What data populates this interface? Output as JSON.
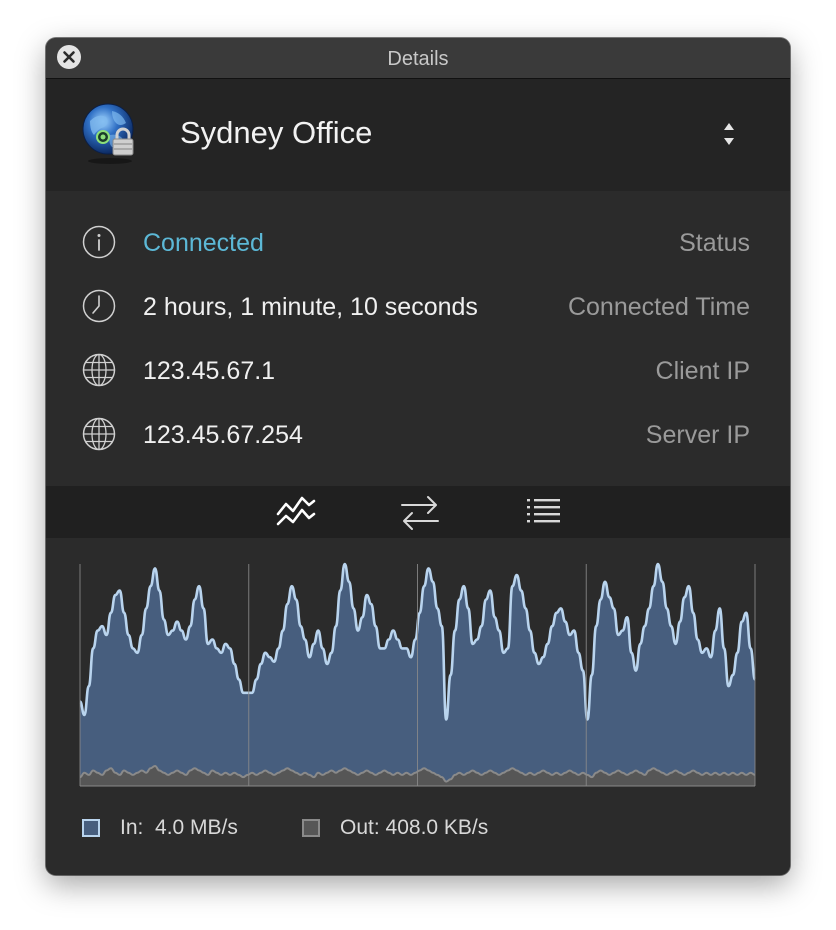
{
  "window": {
    "title": "Details"
  },
  "header": {
    "connection_name": "Sydney Office"
  },
  "info": {
    "rows": [
      {
        "value": "Connected",
        "label": "Status",
        "icon": "info-icon"
      },
      {
        "value": "2 hours, 1 minute, 10 seconds",
        "label": "Connected Time",
        "icon": "clock-icon"
      },
      {
        "value": "123.45.67.1",
        "label": "Client IP",
        "icon": "globe-icon"
      },
      {
        "value": "123.45.67.254",
        "label": "Server IP",
        "icon": "globe-icon"
      }
    ]
  },
  "tabs": [
    {
      "name": "graph",
      "icon": "line-graph-icon",
      "active": true
    },
    {
      "name": "transfer",
      "icon": "transfer-arrows-icon",
      "active": false
    },
    {
      "name": "log",
      "icon": "list-icon",
      "active": false
    }
  ],
  "legend": {
    "in_label": "In:",
    "in_value": "4.0 MB/s",
    "out_label": "Out:",
    "out_value": "408.0 KB/s"
  },
  "colors": {
    "status_connected": "#5cb8d6",
    "in_fill": "#475e7e",
    "in_stroke": "#b9d4ee",
    "out_fill": "#565656",
    "out_stroke": "#8a8a8a"
  },
  "chart_data": {
    "type": "area",
    "ylim": [
      0,
      1
    ],
    "grid": "vertical",
    "legend_position": "bottom",
    "series": [
      {
        "name": "In",
        "values": [
          0.38,
          0.32,
          0.45,
          0.62,
          0.7,
          0.72,
          0.68,
          0.78,
          0.86,
          0.88,
          0.78,
          0.68,
          0.62,
          0.6,
          0.68,
          0.8,
          0.9,
          0.98,
          0.88,
          0.75,
          0.68,
          0.7,
          0.74,
          0.7,
          0.66,
          0.72,
          0.84,
          0.9,
          0.8,
          0.64,
          0.66,
          0.62,
          0.6,
          0.64,
          0.62,
          0.55,
          0.48,
          0.42,
          0.42,
          0.42,
          0.48,
          0.55,
          0.6,
          0.58,
          0.56,
          0.62,
          0.7,
          0.82,
          0.9,
          0.84,
          0.72,
          0.66,
          0.58,
          0.64,
          0.7,
          0.62,
          0.55,
          0.6,
          0.72,
          0.88,
          1.0,
          0.92,
          0.8,
          0.7,
          0.76,
          0.86,
          0.82,
          0.72,
          0.62,
          0.62,
          0.66,
          0.7,
          0.66,
          0.62,
          0.62,
          0.58,
          0.66,
          0.78,
          0.9,
          0.98,
          0.92,
          0.8,
          0.72,
          0.3,
          0.5,
          0.7,
          0.84,
          0.9,
          0.8,
          0.64,
          0.66,
          0.72,
          0.84,
          0.88,
          0.76,
          0.7,
          0.6,
          0.62,
          0.9,
          0.95,
          0.88,
          0.8,
          0.7,
          0.6,
          0.55,
          0.58,
          0.64,
          0.72,
          0.78,
          0.8,
          0.74,
          0.68,
          0.7,
          0.6,
          0.52,
          0.3,
          0.5,
          0.72,
          0.84,
          0.92,
          0.85,
          0.8,
          0.68,
          0.7,
          0.76,
          0.6,
          0.52,
          0.64,
          0.72,
          0.8,
          0.9,
          1.0,
          0.92,
          0.8,
          0.72,
          0.64,
          0.74,
          0.85,
          0.9,
          0.78,
          0.66,
          0.6,
          0.62,
          0.58,
          0.7,
          0.8,
          0.62,
          0.45,
          0.5,
          0.6,
          0.74,
          0.78,
          0.62,
          0.48
        ]
      },
      {
        "name": "Out",
        "values": [
          0.04,
          0.06,
          0.05,
          0.07,
          0.06,
          0.05,
          0.07,
          0.08,
          0.06,
          0.05,
          0.07,
          0.06,
          0.05,
          0.06,
          0.07,
          0.06,
          0.08,
          0.09,
          0.07,
          0.06,
          0.05,
          0.06,
          0.07,
          0.06,
          0.05,
          0.07,
          0.08,
          0.07,
          0.06,
          0.05,
          0.07,
          0.06,
          0.05,
          0.06,
          0.05,
          0.06,
          0.05,
          0.04,
          0.05,
          0.06,
          0.05,
          0.06,
          0.07,
          0.06,
          0.05,
          0.06,
          0.07,
          0.08,
          0.07,
          0.06,
          0.05,
          0.06,
          0.05,
          0.04,
          0.06,
          0.05,
          0.06,
          0.07,
          0.06,
          0.07,
          0.08,
          0.07,
          0.06,
          0.05,
          0.06,
          0.07,
          0.06,
          0.05,
          0.06,
          0.07,
          0.06,
          0.05,
          0.06,
          0.05,
          0.06,
          0.05,
          0.06,
          0.07,
          0.08,
          0.07,
          0.06,
          0.05,
          0.04,
          0.02,
          0.03,
          0.05,
          0.06,
          0.05,
          0.06,
          0.07,
          0.06,
          0.05,
          0.06,
          0.07,
          0.06,
          0.05,
          0.06,
          0.07,
          0.08,
          0.07,
          0.06,
          0.05,
          0.06,
          0.05,
          0.06,
          0.07,
          0.06,
          0.05,
          0.06,
          0.05,
          0.06,
          0.07,
          0.06,
          0.05,
          0.06,
          0.05,
          0.04,
          0.06,
          0.07,
          0.06,
          0.05,
          0.06,
          0.07,
          0.06,
          0.05,
          0.06,
          0.07,
          0.06,
          0.05,
          0.07,
          0.08,
          0.07,
          0.06,
          0.05,
          0.06,
          0.07,
          0.06,
          0.05,
          0.06,
          0.07,
          0.06,
          0.05,
          0.06,
          0.05,
          0.06,
          0.05,
          0.06,
          0.05,
          0.06,
          0.05,
          0.06,
          0.05,
          0.06,
          0.05
        ]
      }
    ]
  }
}
